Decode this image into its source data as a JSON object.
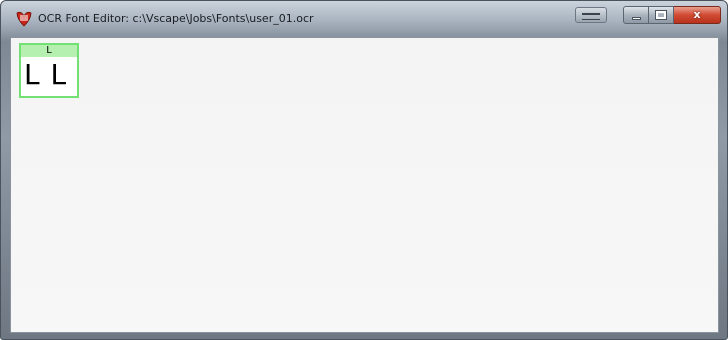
{
  "window": {
    "title": "OCR Font Editor: c:\\Vscape\\Jobs\\Fonts\\user_01.ocr",
    "icon": "ocr-app-icon",
    "buttons": {
      "minimize_icon": "minimize-icon",
      "maximize_icon": "maximize-icon",
      "close_icon": "close-icon",
      "close_label": "x"
    }
  },
  "glyphs": [
    {
      "character": "L",
      "samples": "L L"
    }
  ],
  "colors": {
    "cell_border": "#73e073",
    "cell_header": "#b6f0b0",
    "close_button": "#d14a32"
  }
}
